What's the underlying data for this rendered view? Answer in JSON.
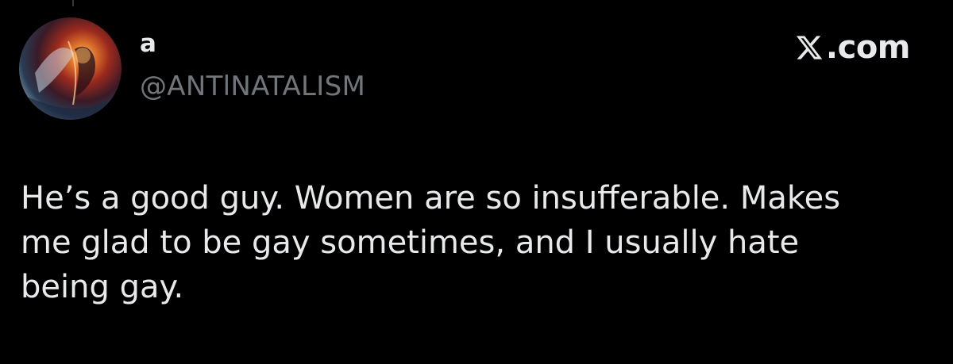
{
  "author": {
    "display_name": "a",
    "handle": "@ANTlNATALISM",
    "avatar": "artistic-flame-figure-avatar"
  },
  "brand": {
    "icon": "x-logo-icon",
    "text": ".com"
  },
  "tweet": {
    "text": "He’s a good guy. Women are so insufferable. Makes\nme glad to be gay sometimes, and I usually hate\nbeing gay."
  },
  "colors": {
    "background": "#000000",
    "primary_text": "#e7e9ea",
    "secondary_text": "#71767b"
  }
}
